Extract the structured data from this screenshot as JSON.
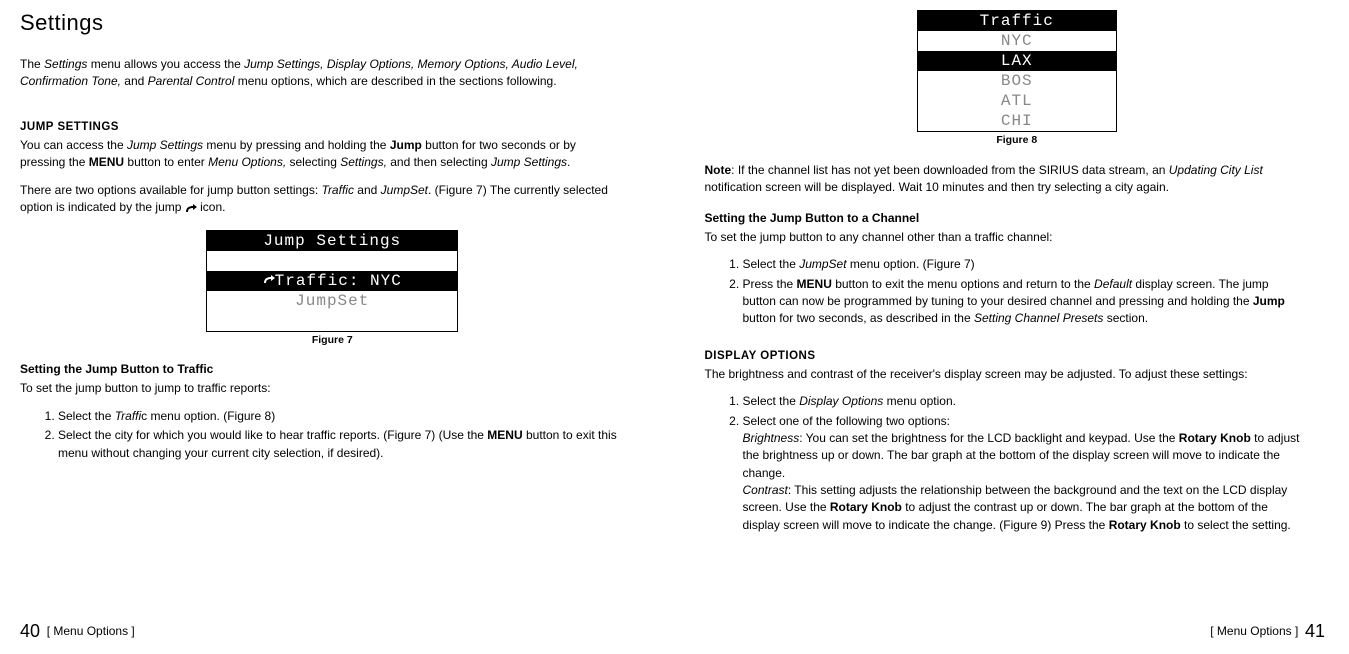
{
  "left": {
    "title": "Settings",
    "intro_a": "The ",
    "intro_b": "Settings",
    "intro_c": " menu allows you access the ",
    "intro_d": "Jump Settings, Display Options, Memory Options, Audio Level, Confirmation Tone,",
    "intro_e": " and ",
    "intro_f": "Parental Control",
    "intro_g": " menu options, which are described in the sections following.",
    "sec1_label": "JUMP SETTINGS",
    "p1a": "You can access the ",
    "p1b": "Jump Settings",
    "p1c": " menu by pressing and holding the ",
    "p1d": "Jump",
    "p1e": " button for two seconds or by pressing the ",
    "p1f": "MENU",
    "p1g": " button to enter ",
    "p1h": "Menu Options,",
    "p1i": " selecting ",
    "p1j": "Settings,",
    "p1k": " and then selecting ",
    "p1l": "Jump Settings",
    "p1m": ".",
    "p2a": "There are two options available for jump button settings: ",
    "p2b": "Traffic",
    "p2c": " and ",
    "p2d": "JumpSet",
    "p2e": ". (Figure 7) The currently selected option is indicated by the jump ",
    "p2f": " icon.",
    "lcd7": {
      "r1": "Jump Settings",
      "r2": "Traffic: NYC",
      "r3": "JumpSet"
    },
    "fig7": "Figure 7",
    "sub1": "Setting the Jump Button to Traffic",
    "p3": "To set the jump button to jump to traffic reports:",
    "steps1": {
      "s1a": "Select the ",
      "s1b": "Traffi",
      "s1c": "c menu option. (Figure 8)",
      "s2a": "Select the city for which you would like to hear traffic reports. (Figure 7) (Use the ",
      "s2b": "MENU",
      "s2c": " button to exit this menu without changing your current city selection, if desired)."
    }
  },
  "right": {
    "lcd8": {
      "r1": "Traffic",
      "r2": "NYC",
      "r3": "LAX",
      "r4": "BOS",
      "r5": "ATL",
      "r6": "CHI"
    },
    "fig8": "Figure 8",
    "note_a": "Note",
    "note_b": ": If the channel list has not yet been downloaded from the SIRIUS data stream, an ",
    "note_c": "Updating City List",
    "note_d": " notification screen will be displayed. Wait 10 minutes and then try selecting a city again.",
    "sub2": "Setting the Jump Button to a Channel",
    "p4": "To set the jump button to any channel other than a traffic channel:",
    "steps2": {
      "s1a": "Select the ",
      "s1b": "JumpSet",
      "s1c": " menu option. (Figure 7)",
      "s2a": "Press the ",
      "s2b": "MENU",
      "s2c": " button to exit the menu options and return to the ",
      "s2d": "Default",
      "s2e": " display screen. The jump button can now be programmed by tuning to your desired channel and pressing and holding the ",
      "s2f": "Jump",
      "s2g": " button for two seconds, as described in the ",
      "s2h": "Setting Channel Presets",
      "s2i": " section."
    },
    "sec2_label": "DISPLAY OPTIONS",
    "p5": "The brightness and contrast of the receiver's display screen may be adjusted. To adjust these settings:",
    "steps3": {
      "s1a": "Select the ",
      "s1b": "Display Options",
      "s1c": " menu option.",
      "s2_intro": "Select one of the following two options:",
      "s2_b1a": "Brightness",
      "s2_b1b": ": You can set the brightness for the LCD backlight and keypad.  Use the ",
      "s2_b1c": "Rotary Knob",
      "s2_b1d": " to adjust the brightness up or down. The bar graph at the bottom of the display screen will move to indicate the change.",
      "s2_c1a": "Contrast",
      "s2_c1b": ": This setting adjusts the relationship between the background and the text on the LCD display screen. Use the ",
      "s2_c1c": "Rotary Knob",
      "s2_c1d": " to adjust the contrast up or down. The bar graph at the bottom of the display screen will move to indicate the change. (Figure 9) Press the ",
      "s2_c1e": "Rotary Knob",
      "s2_c1f": " to select the setting."
    }
  },
  "footer": {
    "left_num": "40",
    "left_label": "[ Menu Options ]",
    "right_label": "[ Menu Options ]",
    "right_num": "41"
  }
}
